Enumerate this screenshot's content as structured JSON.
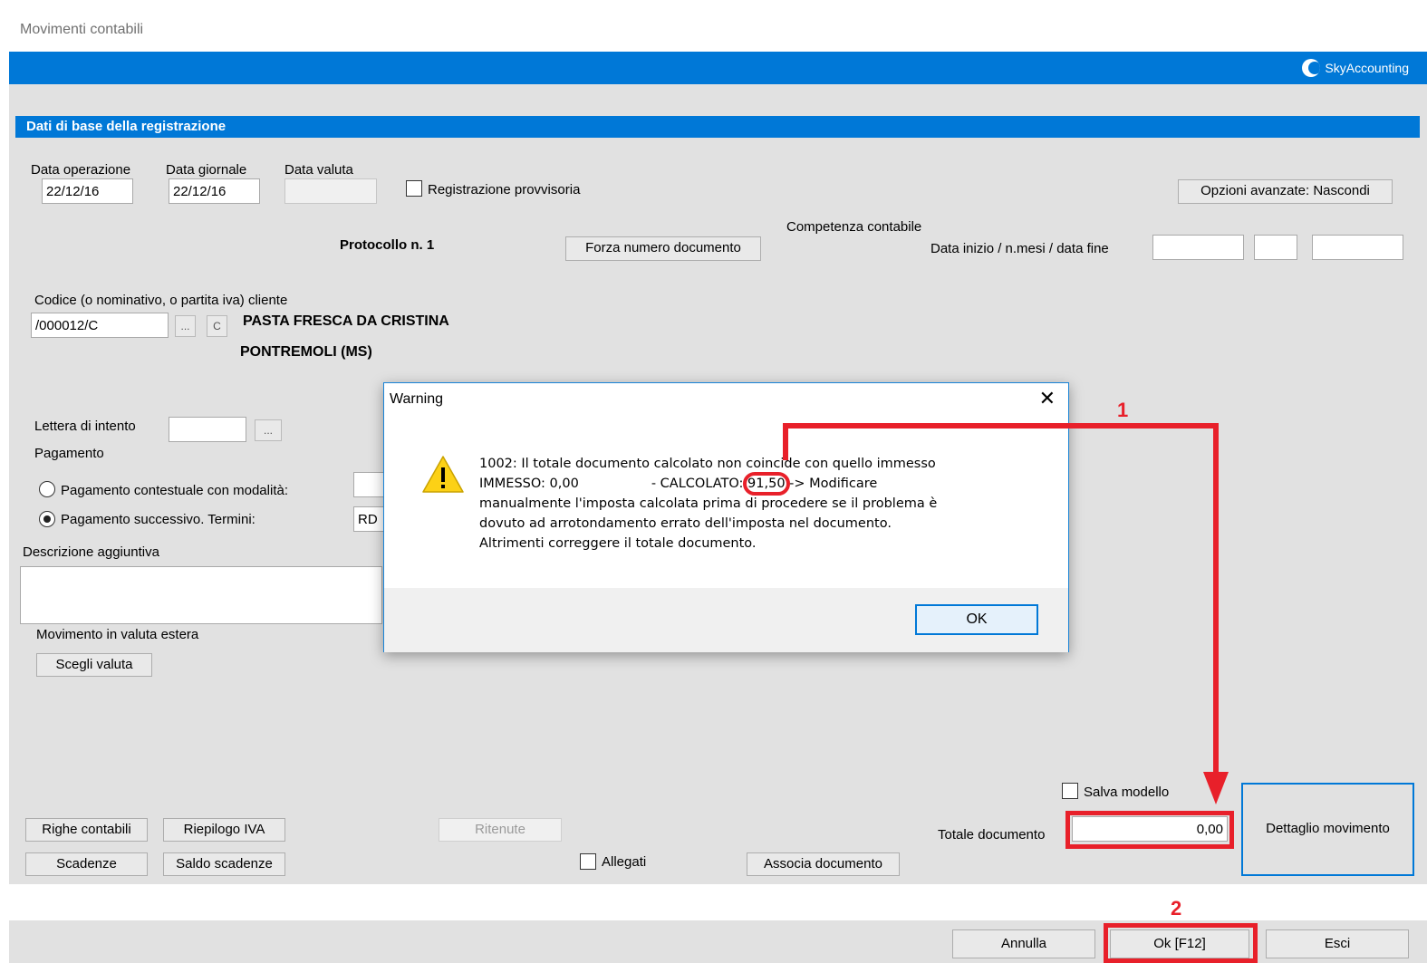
{
  "window": {
    "title": "Movimenti contabili",
    "brand": "SkyAccounting"
  },
  "section": {
    "title": "Dati di base della registrazione"
  },
  "dates": {
    "data_operazione_label": "Data operazione",
    "data_operazione_value": "22/12/16",
    "data_giornale_label": "Data giornale",
    "data_giornale_value": "22/12/16",
    "data_valuta_label": "Data valuta",
    "data_valuta_value": ""
  },
  "registrazione_provvisoria": {
    "label": "Registrazione provvisoria",
    "checked": false
  },
  "opzioni_avanzate_label": "Opzioni avanzate: Nascondi",
  "protocollo_label": "Protocollo n. 1",
  "forza_numero_label": "Forza numero documento",
  "competenza": {
    "title": "Competenza contabile",
    "range_label": "Data inizio / n.mesi / data fine",
    "data_inizio": "",
    "n_mesi": "",
    "data_fine": ""
  },
  "cliente": {
    "label": "Codice (o nominativo, o partita iva) cliente",
    "code": "/000012/C",
    "browse_label": "...",
    "clear_label": "C",
    "name": "PASTA FRESCA DA CRISTINA",
    "city": "PONTREMOLI (MS)"
  },
  "lettera_intento": {
    "label": "Lettera di intento",
    "value": "",
    "browse_label": "..."
  },
  "pagamento": {
    "label": "Pagamento",
    "contestuale_label": "Pagamento contestuale con modalità:",
    "successivo_label": "Pagamento successivo. Termini:",
    "termini_value": "RD",
    "selected": "successivo"
  },
  "descrizione": {
    "label": "Descrizione aggiuntiva",
    "value": ""
  },
  "valuta": {
    "label": "Movimento in valuta estera",
    "button": "Scegli valuta"
  },
  "buttons": {
    "righe_contabili": "Righe contabili",
    "riepilogo_iva": "Riepilogo IVA",
    "ritenute": "Ritenute",
    "scadenze": "Scadenze",
    "saldo_scadenze": "Saldo scadenze",
    "associa_documento": "Associa documento",
    "dettaglio_movimento": "Dettaglio movimento",
    "annulla": "Annulla",
    "ok": "Ok [F12]",
    "esci": "Esci"
  },
  "allegati": {
    "label": "Allegati",
    "checked": false
  },
  "salva_modello": {
    "label": "Salva modello",
    "checked": false
  },
  "totale": {
    "label": "Totale documento",
    "value": "0,00"
  },
  "annotations": {
    "step1": "1",
    "step2": "2"
  },
  "dialog": {
    "title": "Warning",
    "close": "✕",
    "line1": "1002: Il totale documento calcolato non coincide con quello immesso",
    "line2_a": "IMMESSO: 0,00",
    "line2_b": "- CALCOLATO: ",
    "line2_value": "91,50",
    "line2_c": " -> Modificare",
    "line3": "manualmente l'imposta calcolata prima di procedere se il problema è",
    "line4": "dovuto ad arrotondamento errato dell'imposta nel documento.",
    "line5": "Altrimenti  correggere il totale documento.",
    "ok": "OK"
  },
  "colors": {
    "accent": "#0078d7",
    "annotation": "#e8202a",
    "panel": "#e1e1e1"
  }
}
